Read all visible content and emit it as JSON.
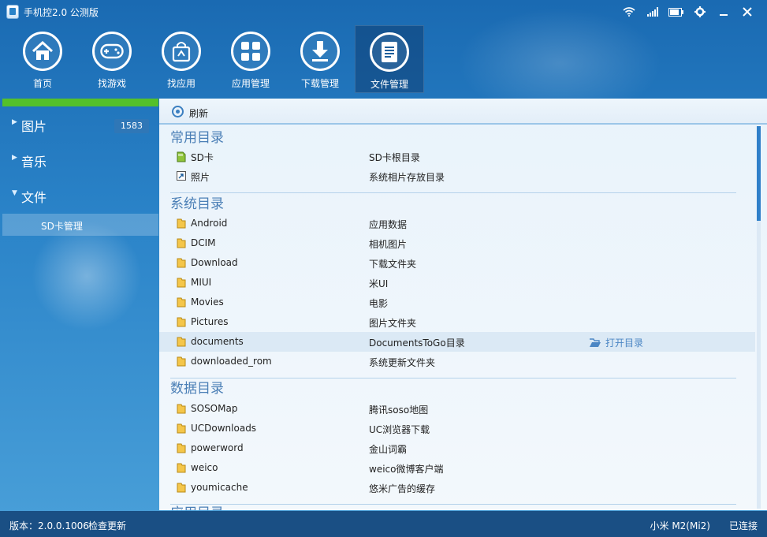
{
  "app": {
    "title": "手机控2.0 公测版"
  },
  "nav": [
    {
      "label": "首页",
      "icon": "home-icon"
    },
    {
      "label": "找游戏",
      "icon": "gamepad-icon"
    },
    {
      "label": "找应用",
      "icon": "app-bag-icon"
    },
    {
      "label": "应用管理",
      "icon": "grid-icon"
    },
    {
      "label": "下载管理",
      "icon": "download-icon"
    },
    {
      "label": "文件管理",
      "icon": "document-icon",
      "active": true
    }
  ],
  "sidebar": {
    "items": [
      {
        "label": "图片",
        "badge": "1583"
      },
      {
        "label": "音乐"
      },
      {
        "label": "文件"
      }
    ],
    "sub_item": "SD卡管理"
  },
  "main": {
    "refresh_label": "刷新",
    "sections": [
      {
        "title": "常用目录",
        "rows": [
          {
            "name": "SD卡",
            "desc": "SD卡根目录",
            "icon": "sd-card-icon"
          },
          {
            "name": "照片",
            "desc": "系统相片存放目录",
            "icon": "shortcut-icon"
          }
        ]
      },
      {
        "title": "系统目录",
        "rows": [
          {
            "name": "Android",
            "desc": "应用数据"
          },
          {
            "name": "DCIM",
            "desc": "相机图片"
          },
          {
            "name": "Download",
            "desc": "下载文件夹"
          },
          {
            "name": "MIUI",
            "desc": "米UI"
          },
          {
            "name": "Movies",
            "desc": "电影"
          },
          {
            "name": "Pictures",
            "desc": "图片文件夹"
          },
          {
            "name": "documents",
            "desc": "DocumentsToGo目录",
            "action": "打开目录"
          },
          {
            "name": "downloaded_rom",
            "desc": "系统更新文件夹"
          }
        ]
      },
      {
        "title": "数据目录",
        "rows": [
          {
            "name": "SOSOMap",
            "desc": "腾讯soso地图"
          },
          {
            "name": "UCDownloads",
            "desc": "UC浏览器下载"
          },
          {
            "name": "powerword",
            "desc": "金山词霸"
          },
          {
            "name": "weico",
            "desc": "weico微博客户端"
          },
          {
            "name": "youmicache",
            "desc": "悠米广告的缓存"
          }
        ]
      },
      {
        "title": "应用目录",
        "rows": []
      }
    ]
  },
  "status": {
    "version": "版本：2.0.0.1006",
    "update": "检查更新",
    "device": "小米 M2(Mi2)",
    "connection": "已连接"
  },
  "colors": {
    "accent": "#2a83c8",
    "active_green": "#54c02b",
    "section_title": "#4b7fb6"
  }
}
